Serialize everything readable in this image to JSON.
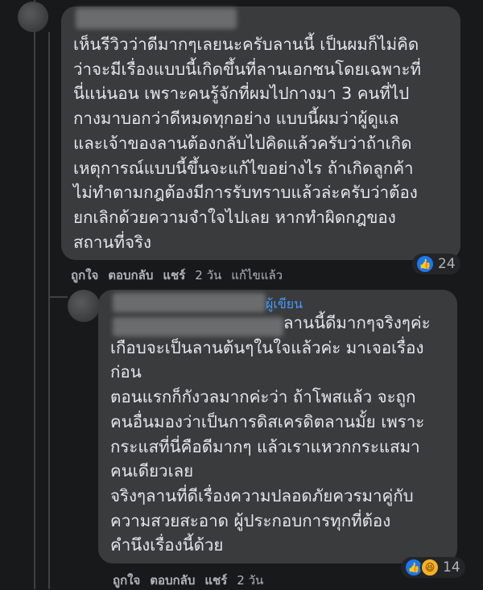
{
  "comment1": {
    "lines": [
      "เห็นรีวิวว่าดีมากๆเลยนะครับลานนี้ เป็นผมก็ไม่คิด",
      "ว่าจะมีเรื่องแบบนี้เกิดขึ้นที่ลานเอกชนโดยเฉพาะที่",
      "นี่แน่นอน เพราะคนรู้จักที่ผมไปกางมา 3 คนที่ไป",
      "กางมาบอกว่าดีหมดทุกอย่าง แบบนี้ผมว่าผู้ดูแล",
      "และเจ้าของลานต้องกลับไปคิดแล้วครับว่าถ้าเกิด",
      "เหตุการณ์แบบนี้ขึ้นจะแก้ไขอย่างไร ถ้าเกิดลูกค้า",
      "ไม่ทำตามกฎต้องมีการรับทราบแล้วล่ะครับว่าต้อง",
      "ยกเลิกด้วยความจำใจไปเลย หากทำผิดกฎของ",
      "สถานที่จริง"
    ],
    "actions": {
      "like": "ถูกใจ",
      "reply": "ตอบกลับ",
      "share": "แชร์",
      "time": "2 วัน",
      "edited": "แก้ไขแล้ว"
    },
    "reaction_count": "24",
    "reaction_icons": [
      "like-icon"
    ]
  },
  "comment2": {
    "author_badge": "ผู้เขียน",
    "lines": [
      "ลานนี้ดีมากๆจริงๆค่ะ",
      "เกือบจะเป็นลานต้นๆในใจแล้วค่ะ มาเจอเรื่อง",
      "ก่อน",
      "ตอนแรกก็กังวลมากค่ะว่า ถ้าโพสแล้ว จะถูก",
      "คนอื่นมองว่าเป็นการดิสเครดิตลานมั้ย เพราะ",
      "กระแสที่นี่คือดีมากๆ แล้วเราแหวกกระแสมา",
      "คนเดียวเลย",
      "จริงๆลานที่ดีเรื่องความปลอดภัยควรมาคู่กับ",
      "ความสวยสะอาด ผู้ประกอบการทุกที่ต้อง",
      "คำนึงเรื่องนี้ด้วย"
    ],
    "actions": {
      "like": "ถูกใจ",
      "reply": "ตอบกลับ",
      "share": "แชร์",
      "time": "2 วัน"
    },
    "reaction_count": "14",
    "reaction_icons": [
      "like-icon",
      "haha-icon"
    ]
  },
  "colors": {
    "background": "#18191a",
    "bubble": "#3a3b3c",
    "text": "#e4e6eb",
    "secondary_text": "#b0b3b8",
    "author_badge": "#4599ff",
    "like": "#1877f2",
    "haha": "#f7b125"
  }
}
